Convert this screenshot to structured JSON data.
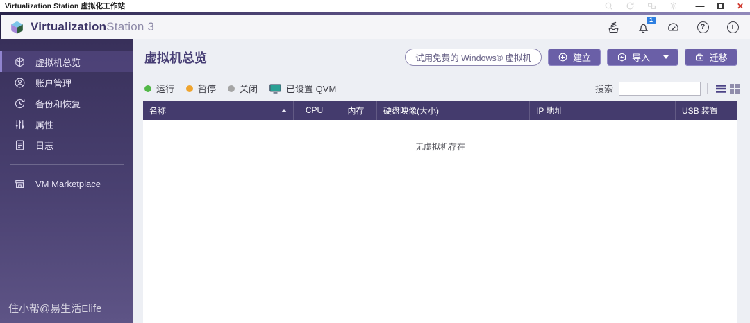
{
  "window": {
    "title": "Virtualization Station 虚拟化工作站",
    "icons": {
      "minimize": "—",
      "maximize": "□",
      "close": "✕"
    }
  },
  "brand": {
    "bold": "Virtualization",
    "light": "Station 3",
    "badge_count": "1",
    "help_glyph": "?",
    "info_glyph": "i"
  },
  "sidebar": {
    "items": [
      {
        "label": "虚拟机总览",
        "icon": "vm-cube-icon",
        "active": true
      },
      {
        "label": "账户管理",
        "icon": "account-icon",
        "active": false
      },
      {
        "label": "备份和恢复",
        "icon": "backup-restore-icon",
        "active": false
      },
      {
        "label": "属性",
        "icon": "properties-sliders-icon",
        "active": false
      },
      {
        "label": "日志",
        "icon": "log-document-icon",
        "active": false
      }
    ],
    "marketplace_label": "VM Marketplace",
    "watermark": "住小帮@易生活Elife"
  },
  "main": {
    "page_title": "虚拟机总览",
    "buttons": {
      "trial": "试用免费的 Windows® 虚拟机",
      "create": "建立",
      "import": "导入",
      "migrate": "迁移"
    },
    "legend": {
      "running": "运行",
      "paused": "暂停",
      "off": "关闭",
      "qvm": "已设置 QVM"
    },
    "search_label": "搜索",
    "search_value": "",
    "table": {
      "columns": [
        "名称",
        "CPU",
        "内存",
        "硬盘映像(大小)",
        "IP 地址",
        "USB 装置"
      ],
      "sort_column": "名称",
      "sort_direction": "asc",
      "empty": "无虚拟机存在"
    }
  },
  "colors": {
    "accent_purple": "#6a5fa7",
    "table_header": "#443b6d",
    "status_running": "#52b847",
    "status_paused": "#efa42e",
    "status_off": "#a5a5a5",
    "qvm_teal": "#2ba094",
    "badge_blue": "#2e7fe1",
    "close_red": "#d0392e"
  }
}
